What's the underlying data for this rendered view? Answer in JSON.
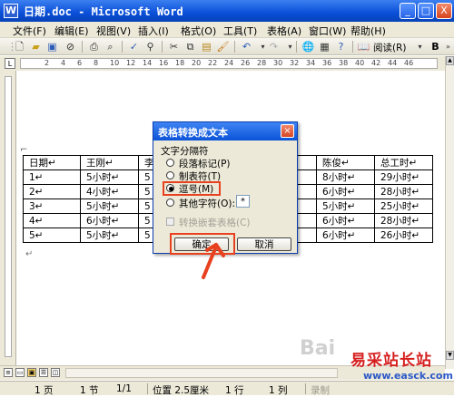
{
  "window": {
    "title": "日期.doc - Microsoft Word",
    "min": "_",
    "max": "□",
    "close": "X"
  },
  "menu": [
    "文件(F)",
    "编辑(E)",
    "视图(V)",
    "插入(I)",
    "格式(O)",
    "工具(T)",
    "表格(A)",
    "窗口(W)",
    "帮助(H)"
  ],
  "toolbar": {
    "reading": "阅读(R)",
    "bold": "B"
  },
  "ruler": {
    "ticks": [
      "2",
      "4",
      "6",
      "8",
      "10",
      "12",
      "14",
      "16",
      "18",
      "20",
      "22",
      "24",
      "26",
      "28",
      "30",
      "32",
      "34",
      "36",
      "38",
      "40",
      "42",
      "44",
      "46"
    ]
  },
  "table": {
    "rows": [
      [
        "日期↵",
        "王刚↵",
        "李",
        "",
        "",
        "陈俊↵",
        "总工时↵"
      ],
      [
        "1↵",
        "5小时↵",
        "5",
        "",
        "",
        "8小时↵",
        "29小时↵"
      ],
      [
        "2↵",
        "4小时↵",
        "5",
        "",
        "",
        "6小时↵",
        "28小时↵"
      ],
      [
        "3↵",
        "5小时↵",
        "5",
        "",
        "",
        "5小时↵",
        "25小时↵"
      ],
      [
        "4↵",
        "6小时↵",
        "5",
        "",
        "",
        "6小时↵",
        "28小时↵"
      ],
      [
        "5↵",
        "5小时↵",
        "5",
        "",
        "",
        "6小时↵",
        "26小时↵"
      ]
    ]
  },
  "dialog": {
    "title": "表格转换成文本",
    "close": "×",
    "group_label": "文字分隔符",
    "options": [
      "段落标记(P)",
      "制表符(T)",
      "逗号(M)",
      "其他字符(O):"
    ],
    "selected": 2,
    "other_char_value": "*",
    "nested_label": "转换嵌套表格(C)",
    "ok_label": "确定",
    "cancel_label": "取消"
  },
  "status": {
    "page": "1 页",
    "section": "1 节",
    "pages": "1/1",
    "position": "位置 2.5厘米",
    "row": "1 行",
    "col": "1 列",
    "rec": "录制"
  },
  "watermark": {
    "a": "Bai",
    "b": "易采站长站",
    "c": "www.easck.com"
  },
  "colors": {
    "title_bar": "#0a4fd8",
    "highlight": "#e8411f"
  }
}
